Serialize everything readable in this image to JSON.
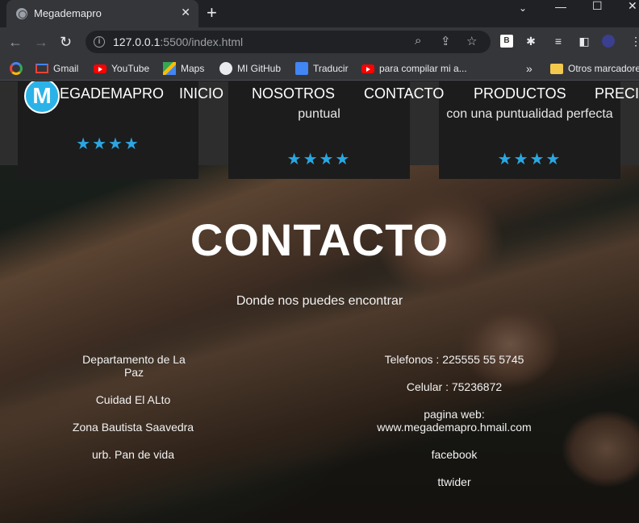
{
  "browser": {
    "tab_title": "Megademapro",
    "url_host": "127.0.0.1",
    "url_rest": ":5500/index.html",
    "bookmarks": [
      {
        "label": "Gmail",
        "icon": "gmail-icon"
      },
      {
        "label": "YouTube",
        "icon": "youtube-icon"
      },
      {
        "label": "Maps",
        "icon": "maps-icon"
      },
      {
        "label": "MI GitHub",
        "icon": "github-icon"
      },
      {
        "label": "Traducir",
        "icon": "translate-icon"
      },
      {
        "label": "para compilar mi a...",
        "icon": "youtube-icon"
      }
    ],
    "other_bookmarks": "Otros marcadores",
    "extension_label": "B"
  },
  "site": {
    "logo_letter": "M",
    "brand": "EGADEMAPRO",
    "nav": [
      "INICIO",
      "NOSOTROS",
      "CONTACTO",
      "PRODUCTOS",
      "PRECI"
    ],
    "cards": [
      {
        "text": "",
        "rating": 4
      },
      {
        "text": "puntual",
        "rating": 4
      },
      {
        "text": "con una puntualidad perfecta",
        "rating": 4
      }
    ],
    "contact": {
      "title": "CONTACTO",
      "subtitle": "Donde nos puedes encontrar",
      "left": [
        "Departamento de La Paz",
        "Cuidad El ALto",
        "Zona Bautista Saavedra",
        "urb. Pan de vida"
      ],
      "right": [
        "Telefonos : 225555 55 5745",
        "Celular : 75236872",
        "pagina web: www.megademapro.hmail.com",
        "facebook",
        "ttwider"
      ]
    }
  },
  "colors": {
    "accent": "#2aa7e3",
    "chrome_dark": "#202124",
    "chrome_toolbar": "#35363a"
  }
}
